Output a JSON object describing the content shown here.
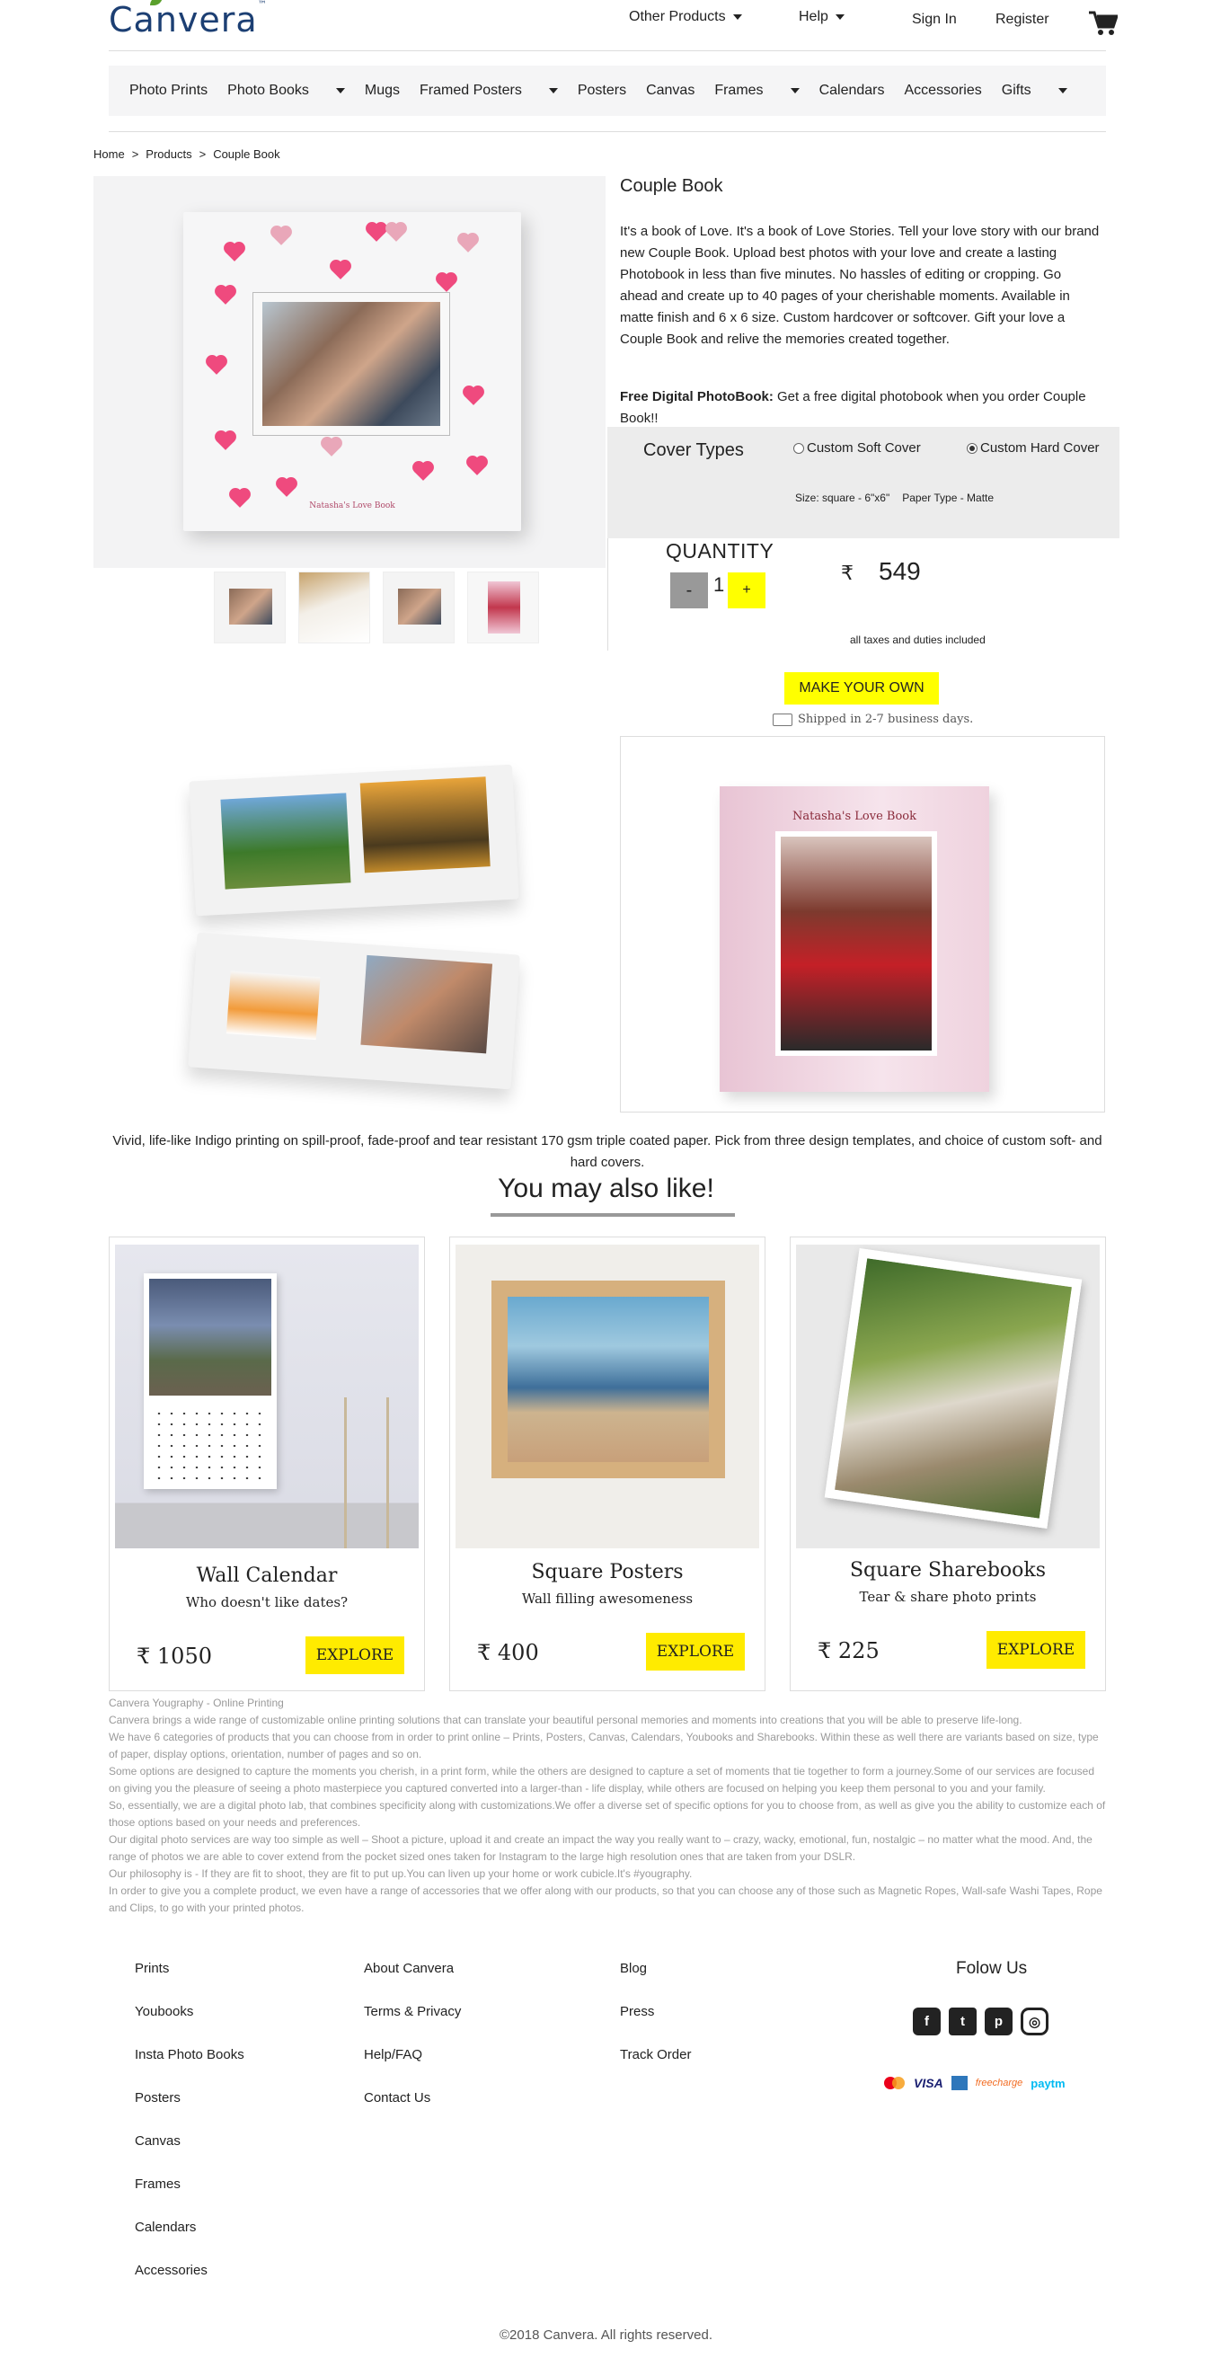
{
  "header": {
    "logo": "Canvera",
    "logo_tm": "™",
    "nav": [
      "Other Products",
      "Help"
    ],
    "sign_in": "Sign In",
    "register": "Register"
  },
  "categories": [
    {
      "label": "Photo Prints",
      "dropdown": false
    },
    {
      "label": "Photo Books",
      "dropdown": true
    },
    {
      "label": "Mugs",
      "dropdown": false
    },
    {
      "label": "Framed Posters",
      "dropdown": true
    },
    {
      "label": "Posters",
      "dropdown": false
    },
    {
      "label": "Canvas",
      "dropdown": false
    },
    {
      "label": "Frames",
      "dropdown": true
    },
    {
      "label": "Calendars",
      "dropdown": false
    },
    {
      "label": "Accessories",
      "dropdown": false
    },
    {
      "label": "Gifts",
      "dropdown": true
    }
  ],
  "breadcrumb": [
    "Home",
    "Products",
    "Couple Book"
  ],
  "product": {
    "title": "Couple Book",
    "book_caption": "Natasha's Love Book",
    "description": "It's a book of Love. It's a book of Love Stories. Tell your love story with our brand new Couple Book. Upload best photos with your love and create a lasting Photobook in less than five minutes. No hassles of editing or cropping. Go ahead and create up to 40 pages of your cherishable moments. Available in matte finish and 6 x 6 size. Custom hardcover or softcover. Gift your love a Couple Book and relive the memories created together.",
    "free_label": "Free Digital PhotoBook:",
    "free_text": " Get a free digital photobook when you order Couple Book!!",
    "cover_types_label": "Cover Types",
    "cover_options": [
      {
        "label": "Custom Soft Cover",
        "selected": false
      },
      {
        "label": "Custom Hard Cover",
        "selected": true
      }
    ],
    "size": "Size: square - 6\"x6\"",
    "paper_type": "Paper Type - Matte",
    "quantity_label": "QUANTITY",
    "quantity": "1",
    "minus": "-",
    "plus": "+",
    "currency": "₹",
    "price": "549",
    "taxes_note": "all taxes and duties included",
    "make_button": "MAKE YOUR OWN",
    "shipping": "Shipped in 2-7 business days.",
    "gallery_book_caption": "Natasha's Love Book",
    "gallery_caption": "Vivid, life-like Indigo printing on spill-proof, fade-proof and tear resistant 170 gsm triple coated paper. Pick from three design templates, and choice of custom soft- and hard covers."
  },
  "also_like": {
    "heading": "You may also like!",
    "items": [
      {
        "title": "Wall Calendar",
        "subtitle": "Who doesn't like dates?",
        "price": "₹ 1050",
        "button": "EXPLORE"
      },
      {
        "title": "Square Posters",
        "subtitle": "Wall filling awesomeness",
        "price": "₹ 400",
        "button": "EXPLORE"
      },
      {
        "title": "Square Sharebooks",
        "subtitle": "Tear & share photo prints",
        "price": "₹ 225",
        "button": "EXPLORE"
      }
    ]
  },
  "about": [
    "Canvera Yougraphy - Online Printing",
    "Canvera brings a wide range of customizable online printing solutions that can translate your beautiful personal memories and moments into creations that you will be able to preserve life-long.",
    "We have 6 categories of products that you can choose from in order to print online – Prints, Posters, Canvas, Calendars, Youbooks and Sharebooks. Within these as well there are variants based on size, type of paper, display options, orientation, number of pages and so on.",
    "Some options are designed to capture the moments you cherish, in a print form, while the others are designed to capture a set of moments that tie together to form a journey.Some of our services are focused on giving you the pleasure of seeing a photo masterpiece you captured converted into a larger-than - life display, while others are focused on helping you keep them personal to you and your family.",
    "So, essentially, we are a digital photo lab, that combines specificity along with customizations.We offer a diverse set of specific options for you to choose from, as well as give you the ability to customize each of those options based on your needs and preferences.",
    "Our digital photo services are way too simple as well – Shoot a picture, upload it and create an impact the way you really want to – crazy, wacky, emotional, fun, nostalgic – no matter what the mood. And, the range of photos we are able to cover extend from the pocket sized ones taken for Instagram to the large high resolution ones that are taken from your DSLR.",
    "Our philosophy is - If they are fit to shoot, they are fit to put up.You can liven up your home or work cubicle.It's #yougraphy.",
    "In order to give you a complete product, we even have a range of accessories that we offer along with our products, so that you can choose any of those such as Magnetic Ropes, Wall-safe Washi Tapes, Rope and Clips, to go with your printed photos."
  ],
  "footer": {
    "col1": [
      "Prints",
      "Youbooks",
      "Insta Photo Books",
      "Posters",
      "Canvas",
      "Frames",
      "Calendars",
      "Accessories"
    ],
    "col2": [
      "About Canvera",
      "Terms & Privacy",
      "Help/FAQ",
      "Contact Us"
    ],
    "col3": [
      "Blog",
      "Press",
      "Track Order"
    ],
    "follow": "Folow Us",
    "social": [
      "f",
      "t",
      "p",
      "◎"
    ],
    "payments": {
      "visa": "VISA",
      "freecharge": "freecharge",
      "paytm": "paytm"
    },
    "copyright": "©2018 Canvera. All rights reserved."
  }
}
